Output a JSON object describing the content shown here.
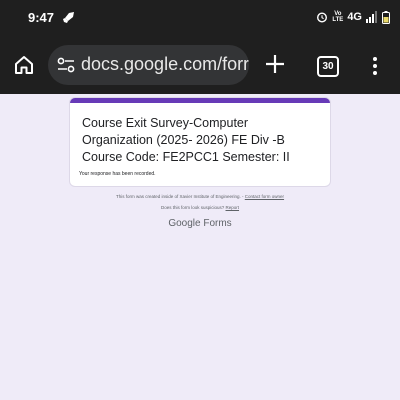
{
  "status_bar": {
    "time": "9:47",
    "volte_label": "Vo\nLTE",
    "network": "4G",
    "icons": [
      "rocket-icon",
      "alarm-icon",
      "signal-icon",
      "battery-icon"
    ]
  },
  "browser": {
    "url": "docs.google.com/forr",
    "tab_count": "30",
    "icons": [
      "home-icon",
      "site-settings-icon",
      "new-tab-icon",
      "menu-icon"
    ]
  },
  "form": {
    "title": " Course Exit Survey-Computer Organization (2025-  2026) FE Div -B\n Course Code: FE2PCC1    Semester: II",
    "response_message": "Your response has been recorded.",
    "accent_color": "#673ab7"
  },
  "footer": {
    "created_text": "This form was created inside of Xavier Institute of Engineering.",
    "contact_link": "Contact form owner",
    "suspicious_text": "Does this form look suspicious?",
    "report_link": "Report",
    "brand_google": "Google",
    "brand_forms": "Forms"
  }
}
